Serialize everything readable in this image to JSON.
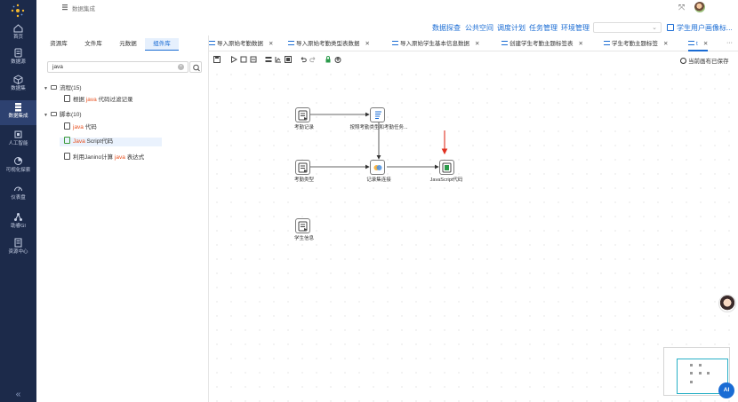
{
  "colors": {
    "rail_bg": "#1c2a4a",
    "accent": "#1a6cd4",
    "highlight": "#e8501f",
    "arrow_red": "#e03020"
  },
  "rail": {
    "items": [
      {
        "label": "首页",
        "icon": "home-icon"
      },
      {
        "label": "数据源",
        "icon": "database-icon"
      },
      {
        "label": "数据集",
        "icon": "cube-icon"
      },
      {
        "label": "数据集成",
        "icon": "integration-icon"
      },
      {
        "label": "人工智能",
        "icon": "ai-chip-icon"
      },
      {
        "label": "可视化探索",
        "icon": "chart-icon"
      },
      {
        "label": "仪表盘",
        "icon": "dashboard-icon"
      },
      {
        "label": "助睿GI",
        "icon": "graph-icon"
      },
      {
        "label": "资源中心",
        "icon": "resource-icon"
      }
    ],
    "collapse": "«"
  },
  "header": {
    "breadcrumb": "数据集成"
  },
  "menu": {
    "items": [
      "数据探查",
      "公共空间",
      "调度计划",
      "任务管理",
      "环境管理"
    ],
    "project": "学生用户画像标..."
  },
  "panel": {
    "tabs": [
      "资源库",
      "文件库",
      "元数据",
      "组件库"
    ],
    "search_value": "java",
    "tree": {
      "flow_group": "流程(15)",
      "flow_item": {
        "pre": "根据 ",
        "hl": "java",
        "post": " 代码过滤记录"
      },
      "script_group": "脚本(10)",
      "script_items": [
        {
          "pre": "",
          "hl": "java",
          "post": " 代码"
        },
        {
          "pre": "",
          "hl": "Java",
          "post": " Script代码"
        },
        {
          "pre": "利用Janino计算 ",
          "hl": "java",
          "post": " 表达式"
        }
      ]
    }
  },
  "doc_tabs": [
    "导入原始考勤数据",
    "导入原始考勤类型表数据",
    "导入原始学生基本信息数据",
    "创建学生考勤主题标签表",
    "学生考勤主题标签",
    "t"
  ],
  "toolbar": {
    "saved": "当前画布已保存"
  },
  "canvas_nodes": [
    {
      "label": "考勤记录",
      "icon": "input-table-icon"
    },
    {
      "label": "按照考勤类型和考勤任务...",
      "icon": "sort-icon"
    },
    {
      "label": "考勤类型",
      "icon": "input-table-icon"
    },
    {
      "label": "记录集连接",
      "icon": "join-icon"
    },
    {
      "label": "JavaScript代码",
      "icon": "script-icon"
    },
    {
      "label": "学生信息",
      "icon": "input-table-icon"
    }
  ],
  "ai_button": "AI"
}
